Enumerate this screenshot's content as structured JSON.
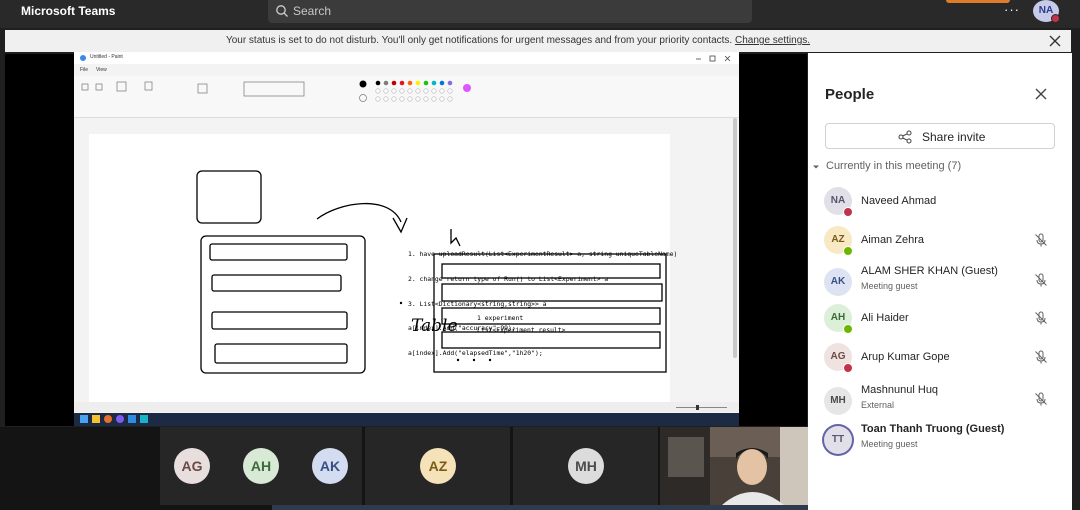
{
  "app": {
    "name": "Microsoft Teams",
    "search_placeholder": "Search",
    "more_label": "···",
    "me_initials": "NA"
  },
  "banner": {
    "text": "Your status is set to do not disturb. You'll only get notifications for urgent messages and from your priority contacts.",
    "link": "Change settings."
  },
  "shared_screen": {
    "window_title": "Untitled - Paint",
    "menu": [
      "File",
      "View"
    ],
    "code_lines": [
      "1. have uploadResult(List<ExperimentResult> a, string uniqueTableName)",
      "2. change return type of Run() to List<Experiment> a",
      "3. List<Dictionary<string,string>> a",
      "a[index].Add(\"accuracy\",99);",
      "a[index].Add(\"elapsedTime\",\"1h20\");"
    ],
    "note_1": "1 experiment",
    "note_2": "List<Experiment result>",
    "hand_label": "Table"
  },
  "strip": {
    "participants": [
      {
        "initials": "AG",
        "bg": "#e8dedd",
        "fg": "#6b4a46"
      },
      {
        "initials": "AH",
        "bg": "#d8ead6",
        "fg": "#3d6b39"
      },
      {
        "initials": "AK",
        "bg": "#d3dcf0",
        "fg": "#3a4f86"
      },
      {
        "initials": "AZ",
        "bg": "#f5e2b8",
        "fg": "#7a5a14"
      },
      {
        "initials": "MH",
        "bg": "#dcdcdc",
        "fg": "#4b4b4b"
      }
    ]
  },
  "people": {
    "title": "People",
    "share_label": "Share invite",
    "section": "Currently in this meeting",
    "count": "(7)",
    "list": [
      {
        "initials": "NA",
        "name": "Naveed Ahmad",
        "sub": "",
        "status": "dnd",
        "mic_off": false,
        "avatar_bg": "#e1dfe8",
        "avatar_fg": "#5a5470"
      },
      {
        "initials": "AZ",
        "name": "Aiman Zehra",
        "sub": "",
        "status": "available",
        "mic_off": true,
        "avatar_bg": "#f8e8c4",
        "avatar_fg": "#7a5a14"
      },
      {
        "initials": "AK",
        "name": "ALAM SHER KHAN (Guest)",
        "sub": "Meeting guest",
        "status": "none",
        "mic_off": true,
        "avatar_bg": "#dde3f3",
        "avatar_fg": "#3a4f86"
      },
      {
        "initials": "AH",
        "name": "Ali Haider",
        "sub": "",
        "status": "available",
        "mic_off": true,
        "avatar_bg": "#dcefd9",
        "avatar_fg": "#3d6b39"
      },
      {
        "initials": "AG",
        "name": "Arup Kumar Gope",
        "sub": "",
        "status": "dnd",
        "mic_off": true,
        "avatar_bg": "#efe2e1",
        "avatar_fg": "#6b4a46"
      },
      {
        "initials": "MH",
        "name": "Mashnunul Huq",
        "sub": "External",
        "status": "none",
        "mic_off": true,
        "avatar_bg": "#e6e6e6",
        "avatar_fg": "#4b4b4b"
      },
      {
        "initials": "TT",
        "name": "Toan Thanh Truong (Guest)",
        "sub": "Meeting guest",
        "status": "none",
        "mic_off": false,
        "avatar_bg": "#e1dfe8",
        "avatar_fg": "#5a5470",
        "bold": true
      }
    ]
  },
  "colors": {
    "dnd": "#c4314b",
    "available": "#6bb700",
    "brand": "#6264a7"
  }
}
